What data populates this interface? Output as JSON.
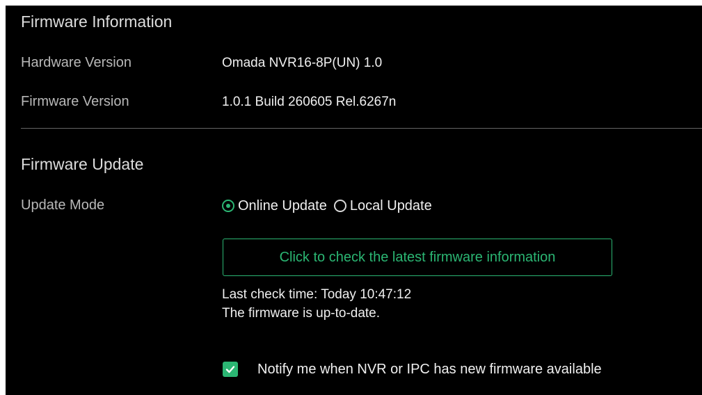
{
  "firmware_info": {
    "title": "Firmware Information",
    "hardware_version_label": "Hardware Version",
    "hardware_version_value": "Omada NVR16-8P(UN) 1.0",
    "firmware_version_label": "Firmware Version",
    "firmware_version_value": "1.0.1 Build 260605 Rel.6267n"
  },
  "firmware_update": {
    "title": "Firmware Update",
    "update_mode_label": "Update Mode",
    "options": [
      {
        "label": "Online Update",
        "selected": true
      },
      {
        "label": "Local Update",
        "selected": false
      }
    ],
    "check_button_label": "Click to check the latest firmware information",
    "last_check_time": "Last check time: Today 10:47:12",
    "status": "The firmware is up-to-date.",
    "notify_label": "Notify me when NVR or IPC has new firmware available",
    "notify_checked": true
  },
  "colors": {
    "accent": "#2bb673",
    "background": "#000000",
    "text": "#f0f0f0",
    "label_text": "#b8b8b8"
  },
  "icons": {
    "radio_selected": "radio-selected-icon",
    "radio_unselected": "radio-unselected-icon",
    "checkbox_checked": "checkmark-icon"
  }
}
